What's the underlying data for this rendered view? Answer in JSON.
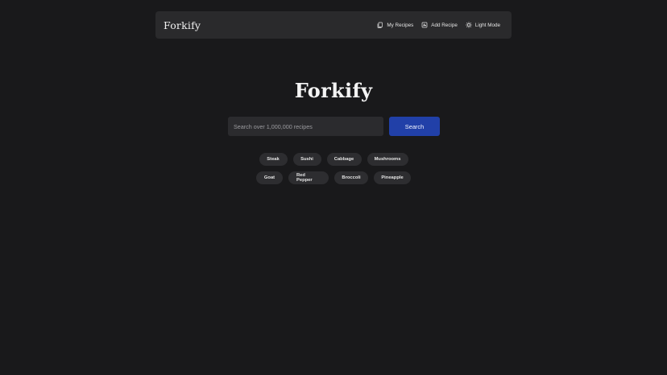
{
  "header": {
    "brand": "Forkify",
    "nav": [
      {
        "label": "My Recipes",
        "icon": "bookmark-stack-icon"
      },
      {
        "label": "Add Recipe",
        "icon": "add-recipe-icon"
      },
      {
        "label": "Light Mode",
        "icon": "sun-icon"
      }
    ]
  },
  "hero": {
    "title": "Forkify"
  },
  "search": {
    "placeholder": "Search over 1,000,000 recipes",
    "value": "",
    "button_label": "Search"
  },
  "suggestions": {
    "row1": [
      "Steak",
      "Sushi",
      "Cabbage",
      "Mushrooms"
    ],
    "row2": [
      "Goat",
      "Red Pepper",
      "Broccoli",
      "Pineapple"
    ]
  },
  "colors": {
    "background": "#19191b",
    "header_bg": "#2a2a2c",
    "accent": "#2140a8",
    "chip_bg": "#2d2d30"
  }
}
